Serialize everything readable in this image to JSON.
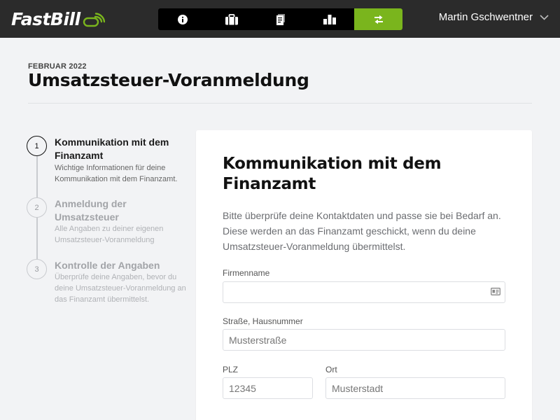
{
  "app": {
    "logo_text": "FastBill",
    "brand_green": "#7ab51d"
  },
  "nav": {
    "items": [
      {
        "icon": "info-icon",
        "active": false
      },
      {
        "icon": "briefcase-icon",
        "active": false
      },
      {
        "icon": "document-icon",
        "active": false
      },
      {
        "icon": "bar-chart-icon",
        "active": false
      },
      {
        "icon": "transfer-arrows-icon",
        "active": true
      }
    ]
  },
  "user": {
    "name": "Martin Gschwentner",
    "menu_icon": "chevron-down-icon"
  },
  "header": {
    "period": "FEBRUAR 2022",
    "title": "Umsatzsteuer-Voranmeldung"
  },
  "steps": [
    {
      "number": "1",
      "title": "Kommunikation mit dem Finanzamt",
      "description": "Wichtige Informationen für deine Kommunikation mit dem Finanzamt.",
      "active": true
    },
    {
      "number": "2",
      "title": "Anmeldung der Umsatzsteuer",
      "description": "Alle Angaben zu deiner eigenen Umsatzsteuer-Voranmeldung",
      "active": false
    },
    {
      "number": "3",
      "title": "Kontrolle der Angaben",
      "description": "Überprüfe deine Angaben, bevor du deine Umsatzsteuer-Voranmeldung an das Finanzamt übermittelst.",
      "active": false
    }
  ],
  "form": {
    "title": "Kommunikation mit dem Finanzamt",
    "intro": "Bitte überprüfe deine Kontaktdaten und passe sie bei Bedarf an. Diese werden an das Finanzamt geschickt, wenn du deine Umsatzsteuer-Voranmeldung übermittelst.",
    "company": {
      "label": "Firmenname",
      "value": "",
      "placeholder": "",
      "icon": "contact-card-icon"
    },
    "street": {
      "label": "Straße, Hausnummer",
      "value": "",
      "placeholder": "Musterstraße"
    },
    "zip": {
      "label": "PLZ",
      "value": "",
      "placeholder": "12345"
    },
    "city": {
      "label": "Ort",
      "value": "",
      "placeholder": "Musterstadt"
    }
  }
}
